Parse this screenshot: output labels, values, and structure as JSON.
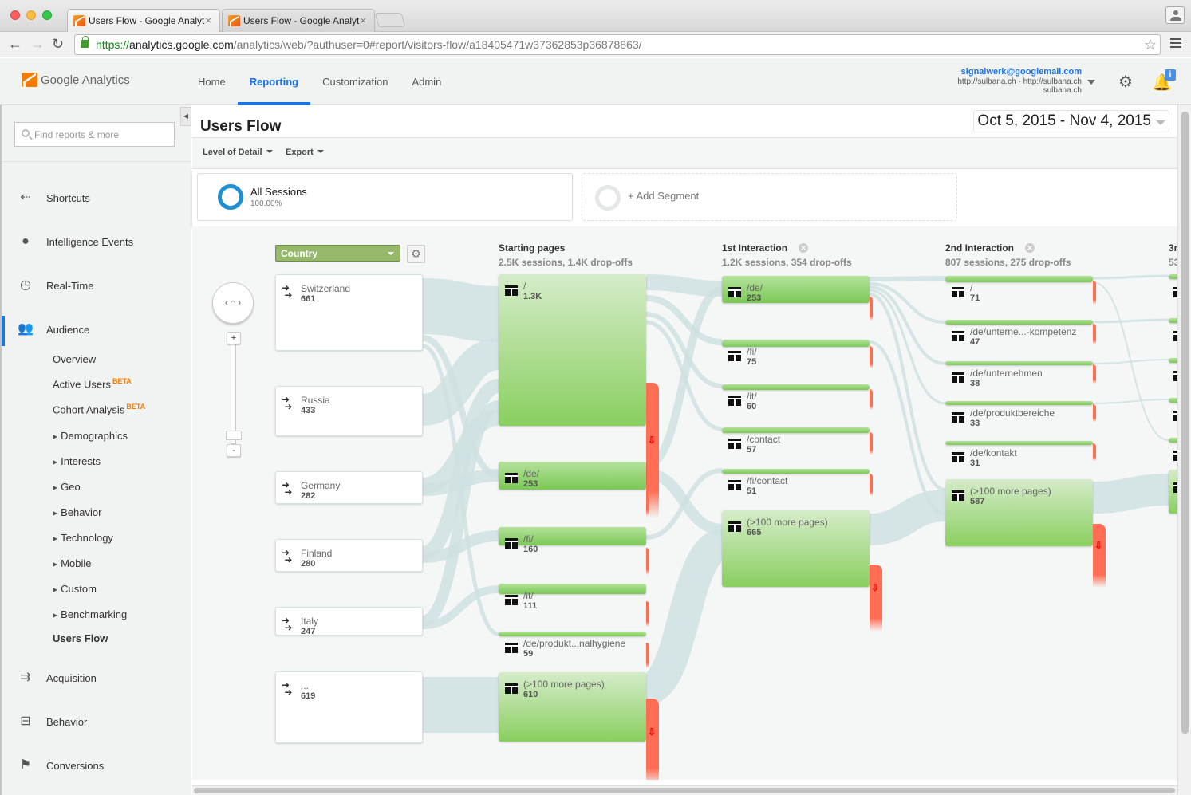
{
  "browser": {
    "tabs": [
      {
        "title": "Users Flow - Google Analyt",
        "active": true
      },
      {
        "title": "Users Flow - Google Analyt",
        "active": false
      }
    ],
    "url_scheme": "https://",
    "url_host": "analytics.google.com",
    "url_path": "/analytics/web/?authuser=0#report/visitors-flow/a18405471w37362853p36878863/"
  },
  "app": {
    "logo_text": "Google Analytics",
    "nav": [
      "Home",
      "Reporting",
      "Customization",
      "Admin"
    ],
    "active_nav": "Reporting",
    "account": {
      "email": "signalwerk@googlemail.com",
      "property": "http://sulbana.ch - http://sulbana.ch",
      "view": "sulbana.ch"
    },
    "notification_badge": "i"
  },
  "sidebar": {
    "search_placeholder": "Find reports & more",
    "sections": [
      {
        "label": "Shortcuts",
        "icon": "shortcut-icon"
      },
      {
        "label": "Intelligence Events",
        "icon": "lightbulb-icon"
      },
      {
        "label": "Real-Time",
        "icon": "clock-icon"
      },
      {
        "label": "Audience",
        "icon": "people-icon",
        "active": true
      },
      {
        "label": "Acquisition",
        "icon": "acquisition-arrows-icon"
      },
      {
        "label": "Behavior",
        "icon": "layout-icon"
      },
      {
        "label": "Conversions",
        "icon": "flag-icon"
      }
    ],
    "audience_items": [
      {
        "label": "Overview"
      },
      {
        "label": "Active Users",
        "badge": "BETA"
      },
      {
        "label": "Cohort Analysis",
        "badge": "BETA"
      },
      {
        "label": "Demographics",
        "expandable": true
      },
      {
        "label": "Interests",
        "expandable": true
      },
      {
        "label": "Geo",
        "expandable": true
      },
      {
        "label": "Behavior",
        "expandable": true
      },
      {
        "label": "Technology",
        "expandable": true
      },
      {
        "label": "Mobile",
        "expandable": true
      },
      {
        "label": "Custom",
        "expandable": true
      },
      {
        "label": "Benchmarking",
        "expandable": true
      },
      {
        "label": "Users Flow",
        "selected": true
      }
    ]
  },
  "report": {
    "title": "Users Flow",
    "date_range": "Oct 5, 2015 - Nov 4, 2015",
    "toolbar": {
      "level_of_detail": "Level of Detail",
      "export": "Export"
    },
    "segment": {
      "name": "All Sessions",
      "percent": "100.00%"
    },
    "add_segment": "+ Add Segment"
  },
  "flow": {
    "dimension": "Country",
    "countries": [
      {
        "label": "Switzerland",
        "value": "661"
      },
      {
        "label": "Russia",
        "value": "433"
      },
      {
        "label": "Germany",
        "value": "282"
      },
      {
        "label": "Finland",
        "value": "280"
      },
      {
        "label": "Italy",
        "value": "247"
      },
      {
        "label": "...",
        "value": "619"
      }
    ],
    "columns": [
      {
        "title": "Starting pages",
        "summary": "2.5K sessions, 1.4K drop-offs",
        "nodes": [
          {
            "label": "/",
            "value": "1.3K"
          },
          {
            "label": "/de/",
            "value": "253"
          },
          {
            "label": "/fi/",
            "value": "160"
          },
          {
            "label": "/it/",
            "value": "111"
          },
          {
            "label": "/de/produkt...nalhygiene",
            "value": "59"
          },
          {
            "label": "(>100 more pages)",
            "value": "610"
          }
        ]
      },
      {
        "title": "1st Interaction",
        "summary": "1.2K sessions, 354 drop-offs",
        "nodes": [
          {
            "label": "/de/",
            "value": "253"
          },
          {
            "label": "/fi/",
            "value": "75"
          },
          {
            "label": "/it/",
            "value": "60"
          },
          {
            "label": "/contact",
            "value": "57"
          },
          {
            "label": "/fi/contact",
            "value": "51"
          },
          {
            "label": "(>100 more pages)",
            "value": "665"
          }
        ]
      },
      {
        "title": "2nd Interaction",
        "summary": "807 sessions, 275 drop-offs",
        "nodes": [
          {
            "label": "/",
            "value": "71"
          },
          {
            "label": "/de/unterne...-kompetenz",
            "value": "47"
          },
          {
            "label": "/de/unternehmen",
            "value": "38"
          },
          {
            "label": "/de/produktbereiche",
            "value": "33"
          },
          {
            "label": "/de/kontakt",
            "value": "31"
          },
          {
            "label": "(>100 more pages)",
            "value": "587"
          }
        ]
      },
      {
        "title": "3r",
        "summary": "53"
      }
    ]
  }
}
